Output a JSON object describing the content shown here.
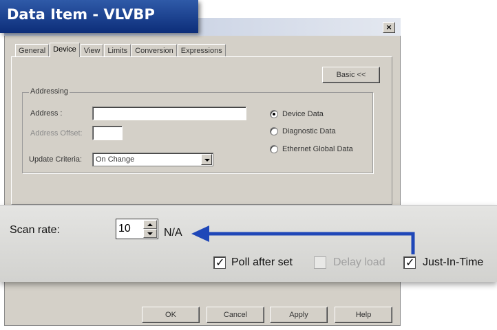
{
  "window": {
    "title": "Data Item - VLVBP",
    "close_glyph": "×"
  },
  "tabs": [
    {
      "label": "General"
    },
    {
      "label": "Device"
    },
    {
      "label": "View"
    },
    {
      "label": "Limits"
    },
    {
      "label": "Conversion"
    },
    {
      "label": "Expressions"
    }
  ],
  "basic_button": "Basic <<",
  "addressing": {
    "group_label": "Addressing",
    "address_label": "Address :",
    "address_value": "",
    "offset_label": "Address Offset:",
    "offset_value": "",
    "update_label": "Update Criteria:",
    "update_value": "On Change",
    "radios": [
      {
        "label": "Device Data",
        "checked": true
      },
      {
        "label": "Diagnostic Data",
        "checked": false
      },
      {
        "label": "Ethernet Global Data",
        "checked": false
      }
    ]
  },
  "scan": {
    "label": "Scan rate:",
    "value": "10",
    "na_text": "N/A",
    "poll_label": "Poll after set",
    "delay_label": "Delay load",
    "jit_label": "Just-In-Time"
  },
  "footer_buttons": [
    "OK",
    "Cancel",
    "Apply",
    "Help"
  ],
  "colors": {
    "title_bar": "#1f4496",
    "arrow": "#1f47b8"
  }
}
